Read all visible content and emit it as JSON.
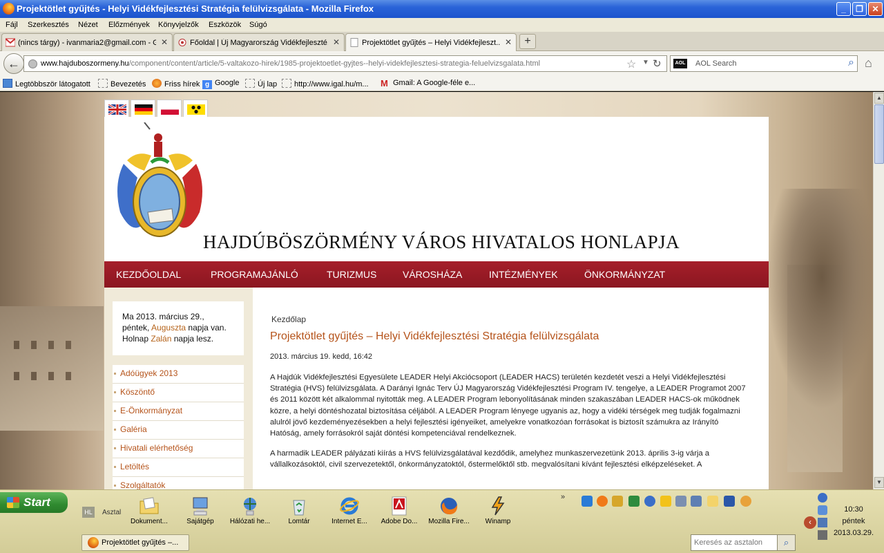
{
  "window": {
    "title": "Projektötlet gyűjtés - Helyi Vidékfejlesztési Stratégia felülvizsgálata - Mozilla Firefox",
    "minimize": "_",
    "maximize": "❐",
    "close": "✕"
  },
  "menu": [
    "Fájl",
    "Szerkesztés",
    "Nézet",
    "Előzmények",
    "Könyvjelzők",
    "Eszközök",
    "Súgó"
  ],
  "tabs": [
    {
      "label": "(nincs tárgy) - ivanmaria2@gmail.com - G...",
      "icon": "gmail-icon"
    },
    {
      "label": "Főoldal | Új Magyarország Vidékfejleszté...",
      "icon": "site-icon"
    },
    {
      "label": "Projektötlet gyűjtés – Helyi Vidékfejleszt...",
      "icon": "blank-page-icon"
    }
  ],
  "tab_close": "✕",
  "newtab": "+",
  "address": {
    "host": "www.hajduboszormeny.hu",
    "path": "/component/content/article/5-valtakozo-hirek/1985-projektoetlet-gyjtes--helyi-videkfejlesztesi-strategia-feluelvizsgalata.html"
  },
  "search": {
    "placeholder": "AOL Search",
    "engine": "AOL"
  },
  "bookmarks": [
    "Legtöbbször látogatott",
    "Bevezetés",
    "Friss hírek",
    "Google",
    "Új lap",
    "http://www.igal.hu/m...",
    "Gmail: A Google-féle e..."
  ],
  "site": {
    "title": "HAJDÚBÖSZÖRMÉNY  VÁROS HIVATALOS HONLAPJA",
    "nav": [
      "KEZDŐOLDAL",
      "PROGRAMAJÁNLÓ",
      "TURIZMUS",
      "VÁROSHÁZA",
      "INTÉZMÉNYEK",
      "ÖNKORMÁNYZAT"
    ],
    "date_line1": "Ma 2013. március 29.,",
    "date_line2a": "péntek, ",
    "date_name1": "Auguszta",
    "date_line2b": " napja van.",
    "date_line3a": "Holnap ",
    "date_name2": "Zalán",
    "date_line3b": " napja lesz.",
    "side_menu": [
      "Adóügyek 2013",
      "Köszöntő",
      "E-Önkormányzat",
      "Galéria",
      "Hivatali elérhetőség",
      "Letöltés",
      "Szolgáltatók"
    ],
    "breadcrumb": "Kezdőlap",
    "article": {
      "title": "Projektötlet gyűjtés – Helyi Vidékfejlesztési Stratégia felülvizsgálata",
      "date": "2013. március 19. kedd, 16:42",
      "p1": "A Hajdúk Vidékfejlesztési Egyesülete LEADER Helyi Akciócsoport (LEADER HACS) területén kezdetét veszi a Helyi Vidékfejlesztési Stratégia (HVS) felülvizsgálata. A Darányi Ignác Terv ÚJ Magyarország Vidékfejlesztési Program IV. tengelye, a LEADER Programot 2007 és 2011 között két alkalommal nyitották meg. A LEADER Program lebonyolításának minden szakaszában LEADER HACS-ok működnek közre, a helyi döntéshozatal biztosítása céljából. A LEADER Program lényege ugyanis az, hogy a vidéki térségek meg tudják fogalmazni alulról jövő kezdeményezésekben a helyi fejlesztési igényeiket, amelyekre vonatkozóan forrásokat is biztosít számukra az Irányító Hatóság, amely forrásokról saját döntési kompetenciával rendelkeznek.",
      "p2": "A harmadik LEADER pályázati kiírás a HVS felülvizsgálatával kezdődik, amelyhez munkaszervezetünk 2013. április 3-ig várja a vállalkozásoktól, civil szervezetektől, önkormányzatoktól, őstermelőktől stb. megvalósítani kívánt fejlesztési elképzeléseket. A"
    }
  },
  "taskbar": {
    "start": "Start",
    "hl": "HL",
    "asztal": "Asztal",
    "quicklaunch": [
      {
        "label": "Dokument...",
        "icon": "folder-icon"
      },
      {
        "label": "Sajátgép",
        "icon": "computer-icon"
      },
      {
        "label": "Hálózati he...",
        "icon": "network-icon"
      },
      {
        "label": "Lomtár",
        "icon": "recycle-bin-icon"
      },
      {
        "label": "Internet E...",
        "icon": "ie-icon"
      },
      {
        "label": "Adobe Do...",
        "icon": "adobe-icon"
      },
      {
        "label": "Mozilla Fire...",
        "icon": "firefox-icon"
      },
      {
        "label": "Winamp",
        "icon": "winamp-icon"
      }
    ],
    "task": "Projektötlet gyűjtés –...",
    "desk_search_placeholder": "Keresés az asztalon",
    "clock_time": "10:30",
    "clock_day": "péntek",
    "clock_date": "2013.03.29.",
    "more": "»"
  }
}
